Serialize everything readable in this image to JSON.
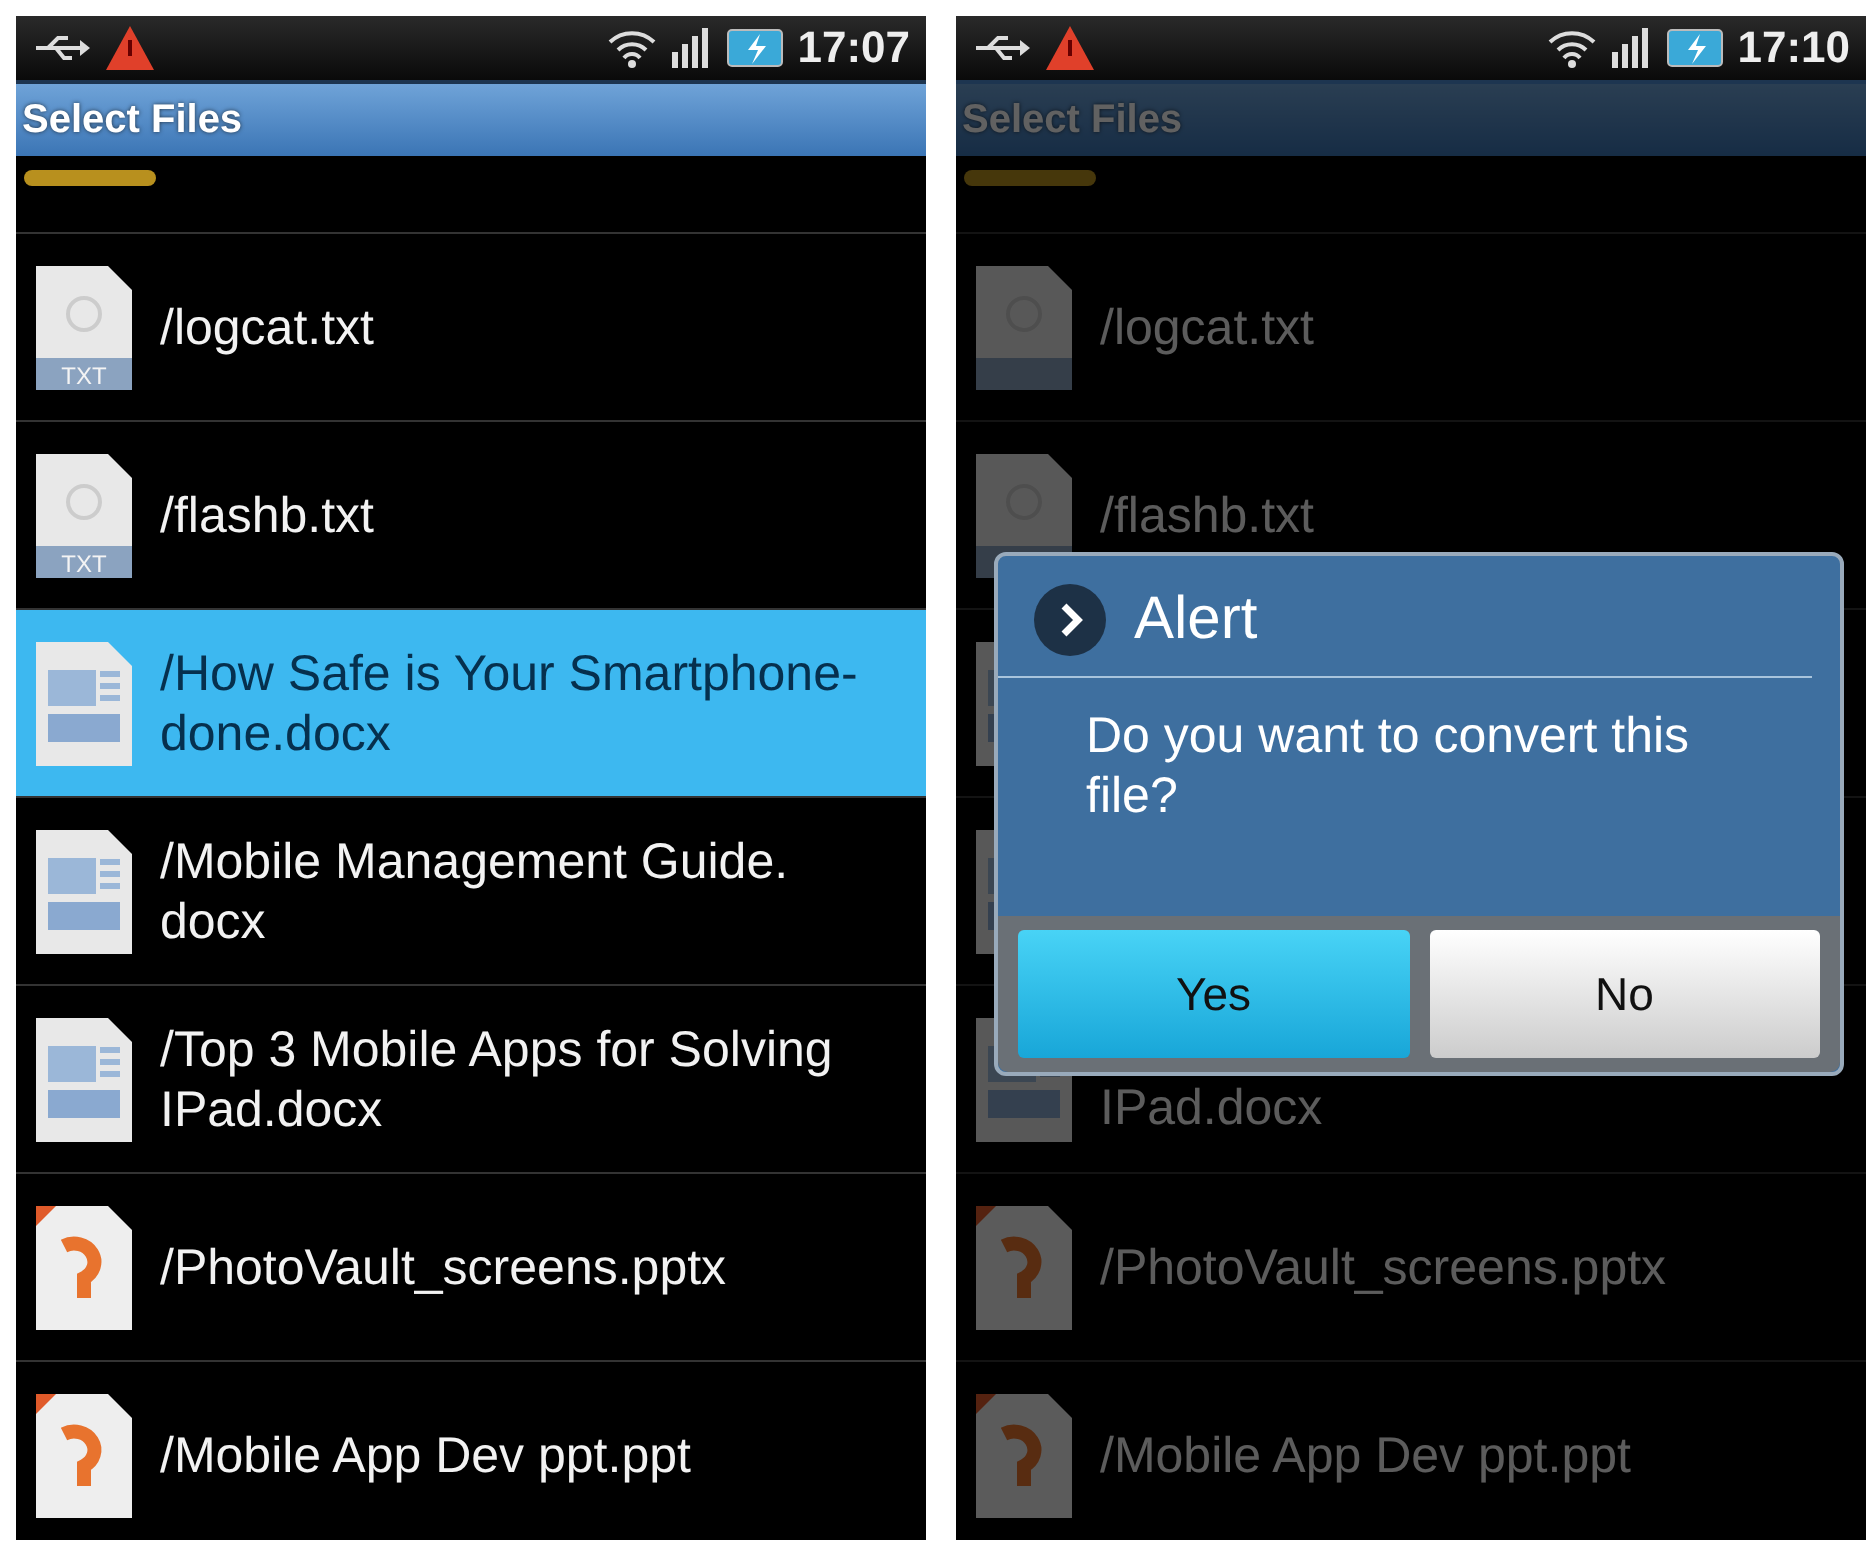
{
  "screens": [
    {
      "status_bar": {
        "time": "17:07"
      },
      "title": "Select Files",
      "dimmed": false,
      "files": [
        {
          "kind": "txt",
          "icon_label": "TXT",
          "lines": [
            "/logcat.txt"
          ],
          "selected": false
        },
        {
          "kind": "txt",
          "icon_label": "TXT",
          "lines": [
            "/flashb.txt"
          ],
          "selected": false
        },
        {
          "kind": "docx",
          "lines": [
            "/How Safe is Your Smartphone-",
            "done.docx"
          ],
          "selected": true
        },
        {
          "kind": "docx",
          "lines": [
            "/Mobile Management Guide.",
            "docx"
          ],
          "selected": false
        },
        {
          "kind": "docx",
          "lines": [
            "/Top 3 Mobile Apps for Solving",
            "IPad.docx"
          ],
          "selected": false
        },
        {
          "kind": "pptx",
          "lines": [
            "/PhotoVault_screens.pptx"
          ],
          "selected": false
        },
        {
          "kind": "pptx",
          "lines": [
            "/Mobile App Dev ppt.ppt"
          ],
          "selected": false
        }
      ]
    },
    {
      "status_bar": {
        "time": "17:10"
      },
      "title": "Select Files",
      "dimmed": true,
      "files": [
        {
          "kind": "txt",
          "lines": [
            "/logcat.txt"
          ],
          "selected": false
        },
        {
          "kind": "txt",
          "lines": [
            "/flashb.txt"
          ],
          "selected": false
        },
        {
          "kind": "docx"
        },
        {
          "kind": "docx"
        },
        {
          "kind": "docx",
          "tail_line": "IPad.docx",
          "selected": false
        },
        {
          "kind": "pptx",
          "lines": [
            "/PhotoVault_screens.pptx"
          ],
          "selected": false
        },
        {
          "kind": "pptx",
          "lines": [
            "/Mobile App Dev ppt.ppt"
          ],
          "selected": false
        }
      ],
      "dialog": {
        "title": "Alert",
        "message": "Do you want to convert this file?",
        "buttons": [
          {
            "label": "Yes",
            "focused": true
          },
          {
            "label": "No",
            "focused": false
          }
        ]
      }
    }
  ]
}
